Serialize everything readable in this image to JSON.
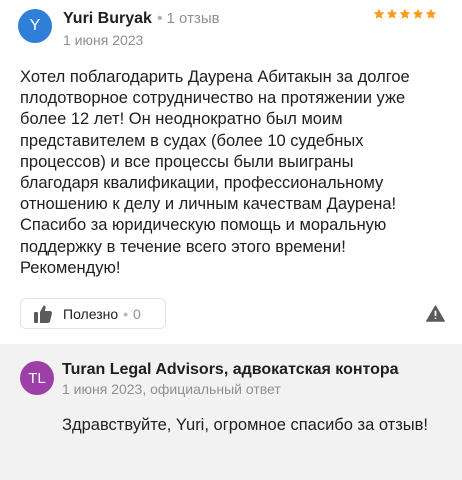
{
  "review": {
    "author_initial": "Y",
    "author_name": "Yuri Buryak",
    "reviews_count": "1 отзыв",
    "date": "1 июня 2023",
    "rating": 5,
    "star_color": "#fc9b1c",
    "avatar_color": "#2f7fd9",
    "text": "Хотел поблагодарить Даурена Абитакын за долгое плодотворное сотрудничество на протяжении уже более 12 лет! Он неоднократно был моим представителем в судах (более 10 судебных процессов) и все процессы были выиграны благодаря квалификации, профессиональному отношению к делу и личным качествам Даурена! Спасибо за юридическую помощь и моральную поддержку в течение всего этого времени! Рекомендую!",
    "useful_label": "Полезно",
    "useful_count": "0",
    "icons": {
      "like": "thumbs-up-icon",
      "report": "warning-icon"
    }
  },
  "reply": {
    "avatar_initials": "TL",
    "avatar_color": "#9c3fa8",
    "author_name": "Turan Legal Advisors, адвокатская контора",
    "meta": "1 июня 2023, официальный ответ",
    "text": "Здравствуйте, Yuri, огромное спасибо за отзыв!"
  }
}
